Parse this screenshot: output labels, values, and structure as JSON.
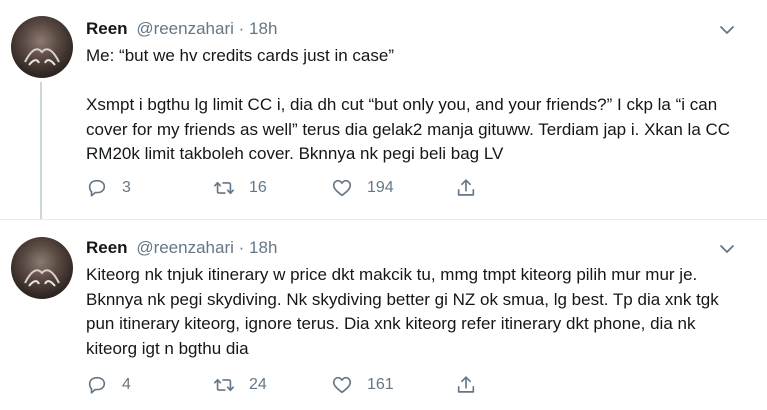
{
  "tweets": [
    {
      "name": "Reen",
      "handle": "@reenzahari",
      "separator": "·",
      "time": "18h",
      "lines": [
        "Me: “but we hv credits cards just in case”",
        "Xsmpt i bgthu lg limit CC i, dia dh cut “but only you, and your friends?” I ckp la “i can cover for my friends as well” terus dia gelak2 manja gituww. Terdiam jap i. Xkan la CC RM20k limit takboleh cover. Bknnya nk pegi beli bag LV"
      ],
      "replies": "3",
      "retweets": "16",
      "likes": "194"
    },
    {
      "name": "Reen",
      "handle": "@reenzahari",
      "separator": "·",
      "time": "18h",
      "lines": [
        "Kiteorg nk tnjuk itinerary w price dkt makcik tu, mmg tmpt kiteorg pilih mur mur je. Bknnya nk pegi skydiving. Nk skydiving better gi NZ ok smua, lg best. Tp dia xnk tgk pun itinerary kiteorg, ignore terus. Dia xnk kiteorg refer itinerary dkt phone, dia nk kiteorg igt n bgthu dia"
      ],
      "replies": "4",
      "retweets": "24",
      "likes": "161"
    }
  ],
  "icons": {
    "reply": "reply-icon",
    "retweet": "retweet-icon",
    "like": "heart-icon",
    "share": "share-icon",
    "more": "chevron-down-icon"
  },
  "colors": {
    "text": "#14171a",
    "secondary": "#657786",
    "thread_line": "#ccd6dd",
    "divider": "#e6ecf0"
  }
}
